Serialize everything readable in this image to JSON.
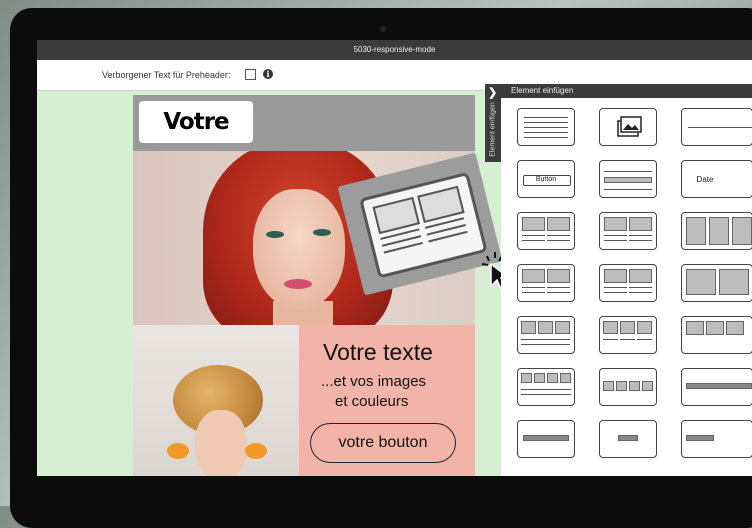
{
  "window": {
    "title": "5030-responsive-mode"
  },
  "preheader": {
    "label": "Verborgener Text für Preheader:"
  },
  "email": {
    "logo_text": "Votre logo",
    "text_title": "Votre texte",
    "text_line1": "...et vos images",
    "text_line2": "et couleurs",
    "button_label": "votre bouton"
  },
  "side_panel": {
    "header": "Element einfügen",
    "tab_label": "Element einfügen",
    "button_tile_label": "Button",
    "date_tile_label": "Date"
  },
  "colors": {
    "canvas_bg": "#d6efd3",
    "text_panel_bg": "#f2b4a9",
    "header_bar": "#3b3b3b"
  }
}
